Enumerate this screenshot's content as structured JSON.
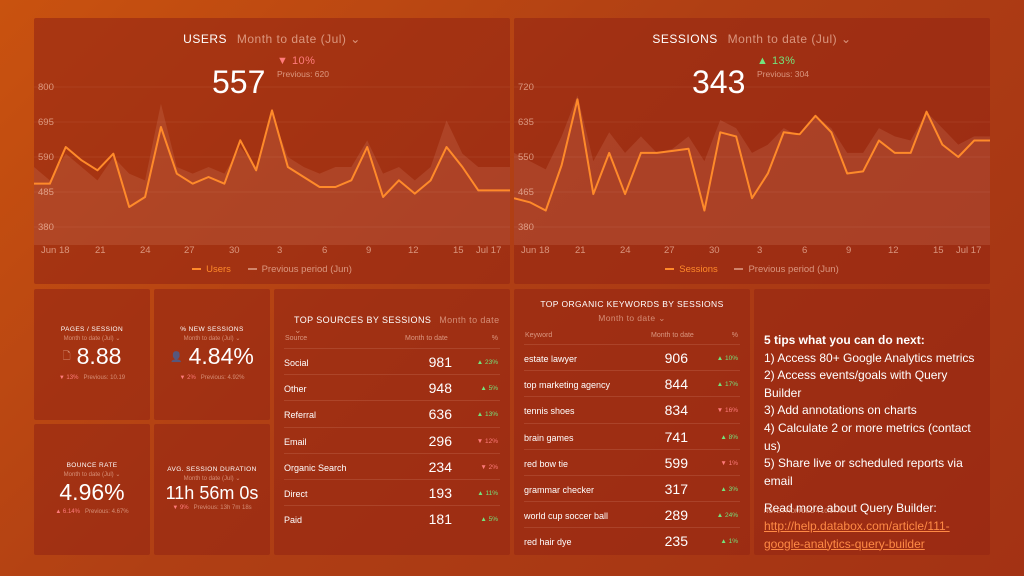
{
  "users_chart": {
    "title": "USERS",
    "period": "Month to date (Jul)",
    "value": "557",
    "delta": "▼ 10%",
    "previous": "Previous: 620",
    "y_ticks": [
      "800",
      "695",
      "590",
      "485",
      "380"
    ],
    "x_ticks": [
      "Jun 18",
      "21",
      "24",
      "27",
      "30",
      "3",
      "6",
      "9",
      "12",
      "15",
      "Jul 17"
    ],
    "legend_current": "Users",
    "legend_previous": "Previous period (Jun)",
    "line_color": "#ff8a2a"
  },
  "sessions_chart": {
    "title": "SESSIONS",
    "period": "Month to date (Jul)",
    "value": "343",
    "delta": "▲ 13%",
    "previous": "Previous: 304",
    "y_ticks": [
      "720",
      "635",
      "550",
      "465",
      "380"
    ],
    "x_ticks": [
      "Jun 18",
      "21",
      "24",
      "27",
      "30",
      "3",
      "6",
      "9",
      "12",
      "15",
      "Jul 17"
    ],
    "legend_current": "Sessions",
    "legend_previous": "Previous period (Jun)",
    "line_color": "#ff8a2a"
  },
  "chart_data": [
    {
      "type": "line",
      "title": "USERS",
      "x": [
        "Jun 18",
        "19",
        "20",
        "21",
        "22",
        "23",
        "24",
        "25",
        "26",
        "27",
        "28",
        "29",
        "30",
        "Jul 1",
        "2",
        "3",
        "4",
        "5",
        "6",
        "7",
        "8",
        "9",
        "10",
        "11",
        "12",
        "13",
        "14",
        "15",
        "16",
        "17",
        "18"
      ],
      "ylim": [
        380,
        800
      ],
      "series": [
        {
          "name": "Users",
          "values": [
            510,
            510,
            620,
            580,
            550,
            600,
            440,
            470,
            680,
            540,
            510,
            530,
            510,
            640,
            550,
            730,
            560,
            530,
            500,
            500,
            520,
            620,
            470,
            520,
            480,
            520,
            620,
            560,
            490,
            490,
            490
          ]
        },
        {
          "name": "Previous period (Jun)",
          "values": [
            560,
            520,
            600,
            560,
            520,
            590,
            540,
            520,
            750,
            560,
            540,
            560,
            540,
            620,
            560,
            720,
            590,
            560,
            540,
            560,
            560,
            640,
            540,
            560,
            520,
            560,
            700,
            600,
            560,
            560,
            560
          ]
        }
      ]
    },
    {
      "type": "line",
      "title": "SESSIONS",
      "x": [
        "Jun 18",
        "19",
        "20",
        "21",
        "22",
        "23",
        "24",
        "25",
        "26",
        "27",
        "28",
        "29",
        "30",
        "Jul 1",
        "2",
        "3",
        "4",
        "5",
        "6",
        "7",
        "8",
        "9",
        "10",
        "11",
        "12",
        "13",
        "14",
        "15",
        "16",
        "17",
        "18"
      ],
      "ylim": [
        380,
        720
      ],
      "series": [
        {
          "name": "Sessions",
          "values": [
            450,
            440,
            420,
            530,
            690,
            460,
            560,
            460,
            560,
            560,
            565,
            570,
            420,
            610,
            600,
            450,
            510,
            610,
            605,
            650,
            610,
            510,
            515,
            590,
            560,
            560,
            660,
            580,
            550,
            590,
            590
          ]
        },
        {
          "name": "Previous period (Jun)",
          "values": [
            560,
            540,
            520,
            600,
            700,
            540,
            610,
            560,
            600,
            560,
            570,
            600,
            540,
            640,
            620,
            560,
            580,
            620,
            600,
            650,
            620,
            560,
            560,
            620,
            600,
            590,
            660,
            620,
            580,
            600,
            600
          ]
        }
      ]
    }
  ],
  "metrics": {
    "pages_per_session": {
      "title": "PAGES / SESSION",
      "period": "Month to date (Jul) ⌄",
      "value": "8.88",
      "delta": "▼ 13%",
      "previous": "Previous: 10.19"
    },
    "new_sessions": {
      "title": "% NEW SESSIONS",
      "period": "Month to date (Jul) ⌄",
      "value": "4.84%",
      "delta": "▼ 2%",
      "previous": "Previous: 4.92%"
    },
    "bounce_rate": {
      "title": "BOUNCE RATE",
      "period": "Month to date (Jul) ⌄",
      "value": "4.96%",
      "delta": "▲ 6.14%",
      "previous": "Previous: 4.67%"
    },
    "avg_session_duration": {
      "title": "AVG. SESSION DURATION",
      "period": "Month to date (Jul) ⌄",
      "value": "11h 56m 0s",
      "delta": "▼ 9%",
      "previous": "Previous: 13h 7m 18s"
    }
  },
  "top_sources": {
    "title": "TOP SOURCES BY SESSIONS",
    "period": "Month to date ⌄",
    "col_source": "Source",
    "col_period": "Month to date",
    "col_pct": "%",
    "rows": [
      {
        "name": "Social",
        "value": "981",
        "change": "▲ 23%",
        "dir": "up"
      },
      {
        "name": "Other",
        "value": "948",
        "change": "▲ 5%",
        "dir": "up"
      },
      {
        "name": "Referral",
        "value": "636",
        "change": "▲ 13%",
        "dir": "up"
      },
      {
        "name": "Email",
        "value": "296",
        "change": "▼ 12%",
        "dir": "down"
      },
      {
        "name": "Organic Search",
        "value": "234",
        "change": "▼ 2%",
        "dir": "down"
      },
      {
        "name": "Direct",
        "value": "193",
        "change": "▲ 11%",
        "dir": "up"
      },
      {
        "name": "Paid",
        "value": "181",
        "change": "▲ 5%",
        "dir": "up"
      }
    ]
  },
  "top_keywords": {
    "title": "TOP ORGANIC KEYWORDS BY SESSIONS",
    "period": "Month to date ⌄",
    "col_keyword": "Keyword",
    "col_period": "Month to date",
    "col_pct": "%",
    "rows": [
      {
        "name": "estate lawyer",
        "value": "906",
        "change": "▲ 10%",
        "dir": "up"
      },
      {
        "name": "top marketing agency",
        "value": "844",
        "change": "▲ 17%",
        "dir": "up"
      },
      {
        "name": "tennis shoes",
        "value": "834",
        "change": "▼ 16%",
        "dir": "down"
      },
      {
        "name": "brain games",
        "value": "741",
        "change": "▲ 8%",
        "dir": "up"
      },
      {
        "name": "red bow tie",
        "value": "599",
        "change": "▼ 1%",
        "dir": "down"
      },
      {
        "name": "grammar checker",
        "value": "317",
        "change": "▲ 3%",
        "dir": "up"
      },
      {
        "name": "world cup soccer ball",
        "value": "289",
        "change": "▲ 24%",
        "dir": "up"
      },
      {
        "name": "red hair dye",
        "value": "235",
        "change": "▲ 1%",
        "dir": "up"
      }
    ]
  },
  "tips": {
    "heading": "5 tips what you can do next:",
    "items": [
      "1) Access 80+ Google Analytics metrics",
      "2) Access events/goals with Query Builder",
      "3) Add annotations on charts",
      "4) Calculate 2 or more metrics (contact us)",
      "5) Share live or scheduled reports via email"
    ],
    "read_more": "Read more about Query Builder:",
    "link_line1": "http://help.databox.com/article/111-",
    "link_line2": "google-analytics-query-builder",
    "note": "NOTE FROM DEC 4 10:14 AM"
  },
  "colors": {
    "up": "#74e37c",
    "down": "#ff7b7b",
    "accent": "#ff8a2a"
  },
  "icons": {
    "pages_per_session": "document-icon",
    "new_sessions": "user-icon",
    "dropdown": "chevron-down-icon"
  }
}
